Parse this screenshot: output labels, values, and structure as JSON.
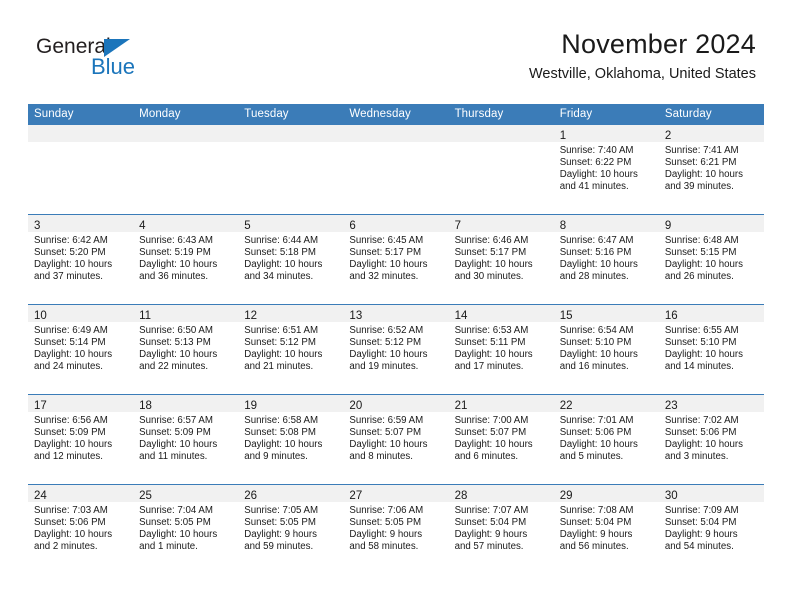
{
  "brand": {
    "name_top": "General",
    "name_bottom": "Blue",
    "triangle_color": "#1b75bb"
  },
  "header": {
    "title": "November 2024",
    "subtitle": "Westville, Oklahoma, United States",
    "accent_color": "#3b7cb8",
    "band_color": "#f1f1f1"
  },
  "weekday_headers": [
    "Sunday",
    "Monday",
    "Tuesday",
    "Wednesday",
    "Thursday",
    "Friday",
    "Saturday"
  ],
  "weeks": [
    [
      {
        "day": "",
        "empty": true
      },
      {
        "day": "",
        "empty": true
      },
      {
        "day": "",
        "empty": true
      },
      {
        "day": "",
        "empty": true
      },
      {
        "day": "",
        "empty": true
      },
      {
        "day": "1",
        "sunrise": "Sunrise: 7:40 AM",
        "sunset": "Sunset: 6:22 PM",
        "daylight_line1": "Daylight: 10 hours",
        "daylight_line2": "and 41 minutes."
      },
      {
        "day": "2",
        "sunrise": "Sunrise: 7:41 AM",
        "sunset": "Sunset: 6:21 PM",
        "daylight_line1": "Daylight: 10 hours",
        "daylight_line2": "and 39 minutes."
      }
    ],
    [
      {
        "day": "3",
        "sunrise": "Sunrise: 6:42 AM",
        "sunset": "Sunset: 5:20 PM",
        "daylight_line1": "Daylight: 10 hours",
        "daylight_line2": "and 37 minutes."
      },
      {
        "day": "4",
        "sunrise": "Sunrise: 6:43 AM",
        "sunset": "Sunset: 5:19 PM",
        "daylight_line1": "Daylight: 10 hours",
        "daylight_line2": "and 36 minutes."
      },
      {
        "day": "5",
        "sunrise": "Sunrise: 6:44 AM",
        "sunset": "Sunset: 5:18 PM",
        "daylight_line1": "Daylight: 10 hours",
        "daylight_line2": "and 34 minutes."
      },
      {
        "day": "6",
        "sunrise": "Sunrise: 6:45 AM",
        "sunset": "Sunset: 5:17 PM",
        "daylight_line1": "Daylight: 10 hours",
        "daylight_line2": "and 32 minutes."
      },
      {
        "day": "7",
        "sunrise": "Sunrise: 6:46 AM",
        "sunset": "Sunset: 5:17 PM",
        "daylight_line1": "Daylight: 10 hours",
        "daylight_line2": "and 30 minutes."
      },
      {
        "day": "8",
        "sunrise": "Sunrise: 6:47 AM",
        "sunset": "Sunset: 5:16 PM",
        "daylight_line1": "Daylight: 10 hours",
        "daylight_line2": "and 28 minutes."
      },
      {
        "day": "9",
        "sunrise": "Sunrise: 6:48 AM",
        "sunset": "Sunset: 5:15 PM",
        "daylight_line1": "Daylight: 10 hours",
        "daylight_line2": "and 26 minutes."
      }
    ],
    [
      {
        "day": "10",
        "sunrise": "Sunrise: 6:49 AM",
        "sunset": "Sunset: 5:14 PM",
        "daylight_line1": "Daylight: 10 hours",
        "daylight_line2": "and 24 minutes."
      },
      {
        "day": "11",
        "sunrise": "Sunrise: 6:50 AM",
        "sunset": "Sunset: 5:13 PM",
        "daylight_line1": "Daylight: 10 hours",
        "daylight_line2": "and 22 minutes."
      },
      {
        "day": "12",
        "sunrise": "Sunrise: 6:51 AM",
        "sunset": "Sunset: 5:12 PM",
        "daylight_line1": "Daylight: 10 hours",
        "daylight_line2": "and 21 minutes."
      },
      {
        "day": "13",
        "sunrise": "Sunrise: 6:52 AM",
        "sunset": "Sunset: 5:12 PM",
        "daylight_line1": "Daylight: 10 hours",
        "daylight_line2": "and 19 minutes."
      },
      {
        "day": "14",
        "sunrise": "Sunrise: 6:53 AM",
        "sunset": "Sunset: 5:11 PM",
        "daylight_line1": "Daylight: 10 hours",
        "daylight_line2": "and 17 minutes."
      },
      {
        "day": "15",
        "sunrise": "Sunrise: 6:54 AM",
        "sunset": "Sunset: 5:10 PM",
        "daylight_line1": "Daylight: 10 hours",
        "daylight_line2": "and 16 minutes."
      },
      {
        "day": "16",
        "sunrise": "Sunrise: 6:55 AM",
        "sunset": "Sunset: 5:10 PM",
        "daylight_line1": "Daylight: 10 hours",
        "daylight_line2": "and 14 minutes."
      }
    ],
    [
      {
        "day": "17",
        "sunrise": "Sunrise: 6:56 AM",
        "sunset": "Sunset: 5:09 PM",
        "daylight_line1": "Daylight: 10 hours",
        "daylight_line2": "and 12 minutes."
      },
      {
        "day": "18",
        "sunrise": "Sunrise: 6:57 AM",
        "sunset": "Sunset: 5:09 PM",
        "daylight_line1": "Daylight: 10 hours",
        "daylight_line2": "and 11 minutes."
      },
      {
        "day": "19",
        "sunrise": "Sunrise: 6:58 AM",
        "sunset": "Sunset: 5:08 PM",
        "daylight_line1": "Daylight: 10 hours",
        "daylight_line2": "and 9 minutes."
      },
      {
        "day": "20",
        "sunrise": "Sunrise: 6:59 AM",
        "sunset": "Sunset: 5:07 PM",
        "daylight_line1": "Daylight: 10 hours",
        "daylight_line2": "and 8 minutes."
      },
      {
        "day": "21",
        "sunrise": "Sunrise: 7:00 AM",
        "sunset": "Sunset: 5:07 PM",
        "daylight_line1": "Daylight: 10 hours",
        "daylight_line2": "and 6 minutes."
      },
      {
        "day": "22",
        "sunrise": "Sunrise: 7:01 AM",
        "sunset": "Sunset: 5:06 PM",
        "daylight_line1": "Daylight: 10 hours",
        "daylight_line2": "and 5 minutes."
      },
      {
        "day": "23",
        "sunrise": "Sunrise: 7:02 AM",
        "sunset": "Sunset: 5:06 PM",
        "daylight_line1": "Daylight: 10 hours",
        "daylight_line2": "and 3 minutes."
      }
    ],
    [
      {
        "day": "24",
        "sunrise": "Sunrise: 7:03 AM",
        "sunset": "Sunset: 5:06 PM",
        "daylight_line1": "Daylight: 10 hours",
        "daylight_line2": "and 2 minutes."
      },
      {
        "day": "25",
        "sunrise": "Sunrise: 7:04 AM",
        "sunset": "Sunset: 5:05 PM",
        "daylight_line1": "Daylight: 10 hours",
        "daylight_line2": "and 1 minute."
      },
      {
        "day": "26",
        "sunrise": "Sunrise: 7:05 AM",
        "sunset": "Sunset: 5:05 PM",
        "daylight_line1": "Daylight: 9 hours",
        "daylight_line2": "and 59 minutes."
      },
      {
        "day": "27",
        "sunrise": "Sunrise: 7:06 AM",
        "sunset": "Sunset: 5:05 PM",
        "daylight_line1": "Daylight: 9 hours",
        "daylight_line2": "and 58 minutes."
      },
      {
        "day": "28",
        "sunrise": "Sunrise: 7:07 AM",
        "sunset": "Sunset: 5:04 PM",
        "daylight_line1": "Daylight: 9 hours",
        "daylight_line2": "and 57 minutes."
      },
      {
        "day": "29",
        "sunrise": "Sunrise: 7:08 AM",
        "sunset": "Sunset: 5:04 PM",
        "daylight_line1": "Daylight: 9 hours",
        "daylight_line2": "and 56 minutes."
      },
      {
        "day": "30",
        "sunrise": "Sunrise: 7:09 AM",
        "sunset": "Sunset: 5:04 PM",
        "daylight_line1": "Daylight: 9 hours",
        "daylight_line2": "and 54 minutes."
      }
    ]
  ]
}
